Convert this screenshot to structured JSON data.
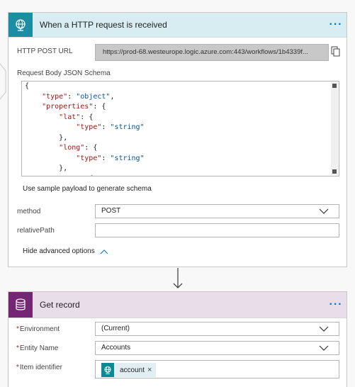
{
  "trigger_card": {
    "title": "When a HTTP request is received",
    "more_label": "···",
    "accent_color": "#1b8ea4",
    "header_bg": "#d7edf1",
    "http_post_url_label": "HTTP POST URL",
    "http_post_url_value": "https://prod-68.westeurope.logic.azure.com:443/workflows/1b4339f...",
    "schema_label": "Request Body JSON Schema",
    "schema_lines": [
      {
        "indent": "",
        "key": "",
        "rest": "{"
      },
      {
        "indent": "    ",
        "key": "\"type\"",
        "rest": ": ",
        "str": "\"object\"",
        "tail": ","
      },
      {
        "indent": "    ",
        "key": "\"properties\"",
        "rest": ": {"
      },
      {
        "indent": "        ",
        "key": "\"lat\"",
        "rest": ": {"
      },
      {
        "indent": "            ",
        "key": "\"type\"",
        "rest": ": ",
        "str": "\"string\""
      },
      {
        "indent": "        ",
        "key": "",
        "rest": "},"
      },
      {
        "indent": "        ",
        "key": "\"long\"",
        "rest": ": {"
      },
      {
        "indent": "            ",
        "key": "\"type\"",
        "rest": ": ",
        "str": "\"string\""
      },
      {
        "indent": "        ",
        "key": "",
        "rest": "},"
      },
      {
        "indent": "        ",
        "key": "\"...\"",
        "rest": ": {"
      }
    ],
    "sample_payload_link": "Use sample payload to generate schema",
    "method_label": "method",
    "method_value": "POST",
    "relative_path_label": "relativePath",
    "relative_path_value": "",
    "advanced_toggle": "Hide advanced options"
  },
  "action_card": {
    "title": "Get record",
    "more_label": "···",
    "accent_color": "#742774",
    "header_bg": "#e8dde8",
    "environment_label": "Environment",
    "environment_value": "(Current)",
    "entity_label": "Entity Name",
    "entity_value": "Accounts",
    "item_label": "Item identifier",
    "item_token_label": "account",
    "item_token_remove": "×",
    "required_mark": "*"
  }
}
